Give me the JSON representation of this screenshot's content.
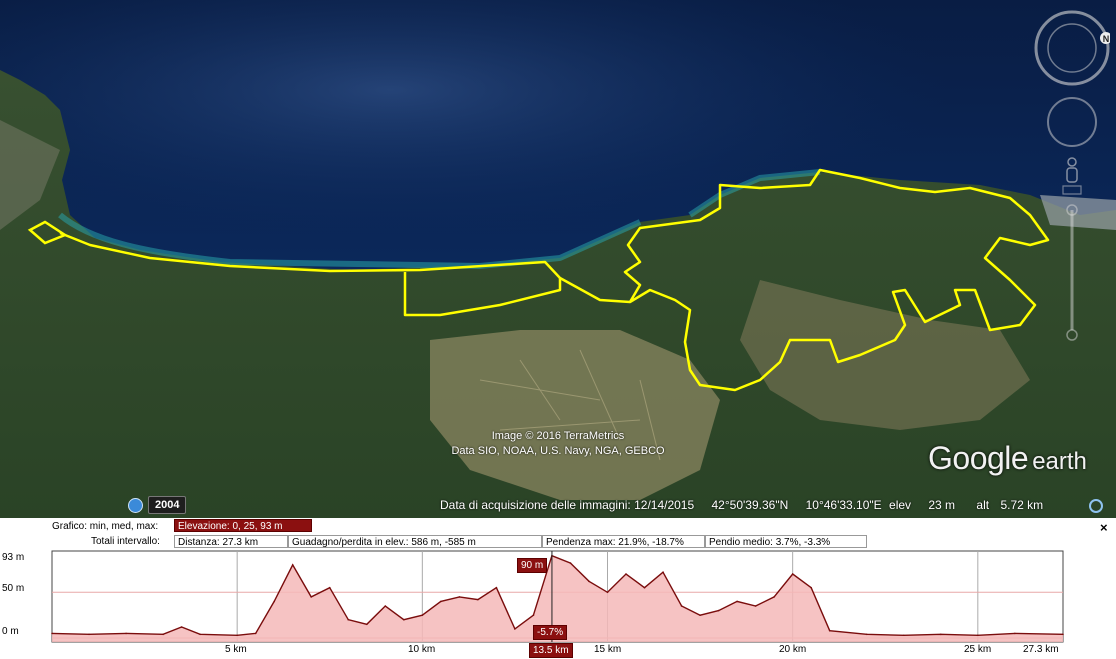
{
  "map": {
    "imagery_credit": "Image © 2016 TerraMetrics",
    "data_credit": "Data SIO, NOAA, U.S. Navy, NGA, GEBCO",
    "logo_main": "Google",
    "logo_sub": "earth",
    "historical_year": "2004",
    "status": {
      "acquisition": "Data di acquisizione delle immagini: 12/14/2015",
      "latitude": "42°50'39.36\"N",
      "longitude": "10°46'33.10\"E",
      "elev_label": "elev",
      "elev_value": "23 m",
      "alt_label": "alt",
      "alt_value": "5.72 km"
    },
    "colors": {
      "boundary": "#ffff00",
      "sea": "#0b2a5c",
      "forest": "#2f4a2a"
    },
    "nav_icons": [
      "compass-ring-icon",
      "look-joystick-icon",
      "pegman-icon",
      "zoom-slider-icon"
    ]
  },
  "profile": {
    "graph_label": "Grafico: min, med, max:",
    "elevation_field": "Elevazione: 0, 25, 93 m",
    "totals_label": "Totali intervallo:",
    "distance_field": "Distanza: 27.3 km",
    "gain_field": "Guadagno/perdita in elev.: 586 m, -585 m",
    "max_slope_field": "Pendenza max: 21.9%, -18.7%",
    "avg_slope_field": "Pendio medio: 3.7%, -3.3%",
    "close_label": "×",
    "y_tick_labels": [
      "93 m",
      "50 m",
      "0 m"
    ],
    "x_tick_labels": [
      "5 km",
      "10 km",
      "15 km",
      "20 km",
      "25 km",
      "27.3 km"
    ],
    "cursor": {
      "distance_label": "13.5 km",
      "elevation_label": "90 m",
      "slope_label": "-5.7%"
    }
  },
  "chart_data": {
    "type": "area",
    "x": [
      0,
      1,
      2,
      3,
      3.5,
      4,
      5,
      5.5,
      6,
      6.5,
      7,
      7.5,
      8,
      8.5,
      9,
      9.5,
      10,
      10.5,
      11,
      11.5,
      12,
      12.5,
      13,
      13.5,
      14,
      14.5,
      15,
      15.5,
      16,
      16.5,
      17,
      17.5,
      18,
      18.5,
      19,
      19.5,
      20,
      20.5,
      21,
      22,
      23,
      24,
      25,
      26,
      27.3
    ],
    "y": [
      5,
      4,
      5,
      4,
      12,
      4,
      3,
      5,
      40,
      80,
      45,
      55,
      20,
      15,
      35,
      20,
      25,
      40,
      45,
      42,
      55,
      10,
      25,
      90,
      82,
      62,
      50,
      70,
      55,
      72,
      35,
      25,
      30,
      40,
      35,
      45,
      70,
      55,
      8,
      4,
      3,
      4,
      3,
      5,
      4
    ],
    "xlim": [
      0,
      27.3
    ],
    "ylim": [
      0,
      93
    ],
    "x_unit": "km",
    "y_unit": "m"
  }
}
